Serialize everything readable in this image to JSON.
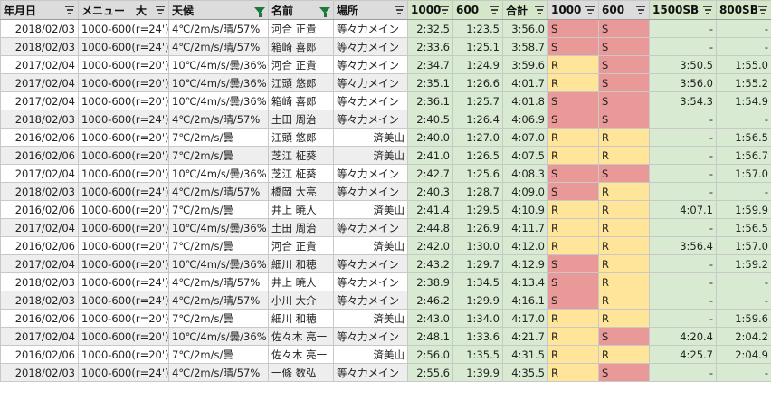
{
  "columns": [
    {
      "key": "date",
      "label": "年月日",
      "filter": "lines"
    },
    {
      "key": "menu",
      "label": "メニュー　大",
      "filter": "lines"
    },
    {
      "key": "weather",
      "label": "天候",
      "filter": "active"
    },
    {
      "key": "name",
      "label": "名前",
      "filter": "active"
    },
    {
      "key": "place",
      "label": "場所",
      "filter": "lines"
    },
    {
      "key": "t1000",
      "label": "1000",
      "filter": "lines"
    },
    {
      "key": "t600",
      "label": "600",
      "filter": "lines"
    },
    {
      "key": "total",
      "label": "合計",
      "filter": "lines"
    },
    {
      "key": "g1000",
      "label": "1000",
      "filter": "lines"
    },
    {
      "key": "g600",
      "label": "600",
      "filter": "lines"
    },
    {
      "key": "sb1500",
      "label": "1500SB",
      "filter": "lines"
    },
    {
      "key": "sb800",
      "label": "800SB",
      "filter": "lines"
    }
  ],
  "rows": [
    {
      "date": "2018/02/03",
      "menu": "1000-600(r=24')",
      "weather": "4℃/2m/s/晴/57%",
      "name": "河合 正貴",
      "place": "等々力メイン",
      "t1000": "2:32.5",
      "t600": "1:23.5",
      "total": "3:56.0",
      "g1000": "S",
      "g600": "S",
      "sb1500": "-",
      "sb800": "-"
    },
    {
      "date": "2018/02/03",
      "menu": "1000-600(r=24')",
      "weather": "4℃/2m/s/晴/57%",
      "name": "箱崎 喜郎",
      "place": "等々力メイン",
      "t1000": "2:33.6",
      "t600": "1:25.1",
      "total": "3:58.7",
      "g1000": "S",
      "g600": "S",
      "sb1500": "-",
      "sb800": "-"
    },
    {
      "date": "2017/02/04",
      "menu": "1000-600(r=20')",
      "weather": "10℃/4m/s/曇/36%",
      "name": "河合 正貴",
      "place": "等々力メイン",
      "t1000": "2:34.7",
      "t600": "1:24.9",
      "total": "3:59.6",
      "g1000": "R",
      "g600": "S",
      "sb1500": "3:50.5",
      "sb800": "1:55.0"
    },
    {
      "date": "2017/02/04",
      "menu": "1000-600(r=20')",
      "weather": "10℃/4m/s/曇/36%",
      "name": "江頭 悠郎",
      "place": "等々力メイン",
      "t1000": "2:35.1",
      "t600": "1:26.6",
      "total": "4:01.7",
      "g1000": "R",
      "g600": "S",
      "sb1500": "3:56.0",
      "sb800": "1:55.2"
    },
    {
      "date": "2017/02/04",
      "menu": "1000-600(r=20')",
      "weather": "10℃/4m/s/曇/36%",
      "name": "箱崎 喜郎",
      "place": "等々力メイン",
      "t1000": "2:36.1",
      "t600": "1:25.7",
      "total": "4:01.8",
      "g1000": "S",
      "g600": "S",
      "sb1500": "3:54.3",
      "sb800": "1:54.9"
    },
    {
      "date": "2018/02/03",
      "menu": "1000-600(r=24')",
      "weather": "4℃/2m/s/晴/57%",
      "name": "土田 周治",
      "place": "等々力メイン",
      "t1000": "2:40.5",
      "t600": "1:26.4",
      "total": "4:06.9",
      "g1000": "S",
      "g600": "S",
      "sb1500": "-",
      "sb800": "-"
    },
    {
      "date": "2016/02/06",
      "menu": "1000-600(r=20')",
      "weather": "7℃/2m/s/曇",
      "name": "江頭 悠郎",
      "place": "済美山",
      "t1000": "2:40.0",
      "t600": "1:27.0",
      "total": "4:07.0",
      "g1000": "R",
      "g600": "R",
      "sb1500": "-",
      "sb800": "1:56.5"
    },
    {
      "date": "2016/02/06",
      "menu": "1000-600(r=20')",
      "weather": "7℃/2m/s/曇",
      "name": "芝江 柾葵",
      "place": "済美山",
      "t1000": "2:41.0",
      "t600": "1:26.5",
      "total": "4:07.5",
      "g1000": "R",
      "g600": "R",
      "sb1500": "-",
      "sb800": "1:56.7"
    },
    {
      "date": "2017/02/04",
      "menu": "1000-600(r=20')",
      "weather": "10℃/4m/s/曇/36%",
      "name": "芝江 柾葵",
      "place": "等々力メイン",
      "t1000": "2:42.7",
      "t600": "1:25.6",
      "total": "4:08.3",
      "g1000": "S",
      "g600": "S",
      "sb1500": "-",
      "sb800": "1:57.0"
    },
    {
      "date": "2018/02/03",
      "menu": "1000-600(r=24')",
      "weather": "4℃/2m/s/晴/57%",
      "name": "橋岡 大亮",
      "place": "等々力メイン",
      "t1000": "2:40.3",
      "t600": "1:28.7",
      "total": "4:09.0",
      "g1000": "S",
      "g600": "R",
      "sb1500": "-",
      "sb800": "-"
    },
    {
      "date": "2016/02/06",
      "menu": "1000-600(r=20')",
      "weather": "7℃/2m/s/曇",
      "name": "井上 暁人",
      "place": "済美山",
      "t1000": "2:41.4",
      "t600": "1:29.5",
      "total": "4:10.9",
      "g1000": "R",
      "g600": "R",
      "sb1500": "4:07.1",
      "sb800": "1:59.9"
    },
    {
      "date": "2017/02/04",
      "menu": "1000-600(r=20')",
      "weather": "10℃/4m/s/曇/36%",
      "name": "土田 周治",
      "place": "等々力メイン",
      "t1000": "2:44.8",
      "t600": "1:26.9",
      "total": "4:11.7",
      "g1000": "R",
      "g600": "R",
      "sb1500": "-",
      "sb800": "1:56.5"
    },
    {
      "date": "2016/02/06",
      "menu": "1000-600(r=20')",
      "weather": "7℃/2m/s/曇",
      "name": "河合 正貴",
      "place": "済美山",
      "t1000": "2:42.0",
      "t600": "1:30.0",
      "total": "4:12.0",
      "g1000": "R",
      "g600": "R",
      "sb1500": "3:56.4",
      "sb800": "1:57.0"
    },
    {
      "date": "2017/02/04",
      "menu": "1000-600(r=20')",
      "weather": "10℃/4m/s/曇/36%",
      "name": "細川 和穂",
      "place": "等々力メイン",
      "t1000": "2:43.2",
      "t600": "1:29.7",
      "total": "4:12.9",
      "g1000": "S",
      "g600": "R",
      "sb1500": "-",
      "sb800": "1:59.2"
    },
    {
      "date": "2018/02/03",
      "menu": "1000-600(r=24')",
      "weather": "4℃/2m/s/晴/57%",
      "name": "井上 暁人",
      "place": "等々力メイン",
      "t1000": "2:38.9",
      "t600": "1:34.5",
      "total": "4:13.4",
      "g1000": "S",
      "g600": "R",
      "sb1500": "-",
      "sb800": "-"
    },
    {
      "date": "2018/02/03",
      "menu": "1000-600(r=24')",
      "weather": "4℃/2m/s/晴/57%",
      "name": "小川 大介",
      "place": "等々力メイン",
      "t1000": "2:46.2",
      "t600": "1:29.9",
      "total": "4:16.1",
      "g1000": "S",
      "g600": "R",
      "sb1500": "-",
      "sb800": "-"
    },
    {
      "date": "2016/02/06",
      "menu": "1000-600(r=20')",
      "weather": "7℃/2m/s/曇",
      "name": "細川 和穂",
      "place": "済美山",
      "t1000": "2:43.0",
      "t600": "1:34.0",
      "total": "4:17.0",
      "g1000": "R",
      "g600": "R",
      "sb1500": "-",
      "sb800": "1:59.6"
    },
    {
      "date": "2017/02/04",
      "menu": "1000-600(r=20')",
      "weather": "10℃/4m/s/曇/36%",
      "name": "佐々木 亮一",
      "place": "等々力メイン",
      "t1000": "2:48.1",
      "t600": "1:33.6",
      "total": "4:21.7",
      "g1000": "R",
      "g600": "S",
      "sb1500": "4:20.4",
      "sb800": "2:04.2"
    },
    {
      "date": "2016/02/06",
      "menu": "1000-600(r=20')",
      "weather": "7℃/2m/s/曇",
      "name": "佐々木 亮一",
      "place": "済美山",
      "t1000": "2:56.0",
      "t600": "1:35.5",
      "total": "4:31.5",
      "g1000": "R",
      "g600": "R",
      "sb1500": "4:25.7",
      "sb800": "2:04.9"
    },
    {
      "date": "2018/02/03",
      "menu": "1000-600(r=24')",
      "weather": "4℃/2m/s/晴/57%",
      "name": "一條 数弘",
      "place": "等々力メイン",
      "t1000": "2:55.6",
      "t600": "1:39.9",
      "total": "4:35.5",
      "g1000": "R",
      "g600": "S",
      "sb1500": "-",
      "sb800": "-"
    }
  ],
  "colors": {
    "header_bg": "#dcdcdc",
    "header_green_bg": "#d4e8c9",
    "alt_row_bg": "#eeeeee",
    "time_cell_bg": "#d9ead3",
    "grade_S_bg": "#ea9999",
    "grade_R_bg": "#ffe599",
    "active_filter_icon": "#1b7a3a"
  },
  "icons": {
    "filter": "filter-lines-icon",
    "active_filter": "funnel-icon"
  }
}
